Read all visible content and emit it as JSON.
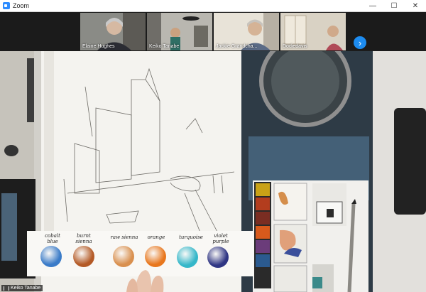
{
  "window": {
    "title": "Zoom"
  },
  "window_controls": {
    "minimize": "—",
    "maximize": "☐",
    "close": "✕"
  },
  "participants": [
    {
      "name": "Elaine Hughes"
    },
    {
      "name": "Keiko Tanabe"
    },
    {
      "name": "Jackie Grandcha..."
    },
    {
      "name": "Dodiedavis"
    }
  ],
  "next_label": "›",
  "speaker": {
    "name": "Keiko Tanabe"
  },
  "swatches": [
    {
      "label_1": "cobalt",
      "label_2": "blue",
      "color": "#3a7bc8"
    },
    {
      "label_1": "burnt",
      "label_2": "sienna",
      "color": "#b45a26"
    },
    {
      "label_1": "raw sienna",
      "label_2": "",
      "color": "#d9904f"
    },
    {
      "label_1": "orange",
      "label_2": "",
      "color": "#e8771e"
    },
    {
      "label_1": "turquoise",
      "label_2": "",
      "color": "#35b7c9"
    },
    {
      "label_1": "violet",
      "label_2": "purple",
      "color": "#2f3583"
    }
  ]
}
